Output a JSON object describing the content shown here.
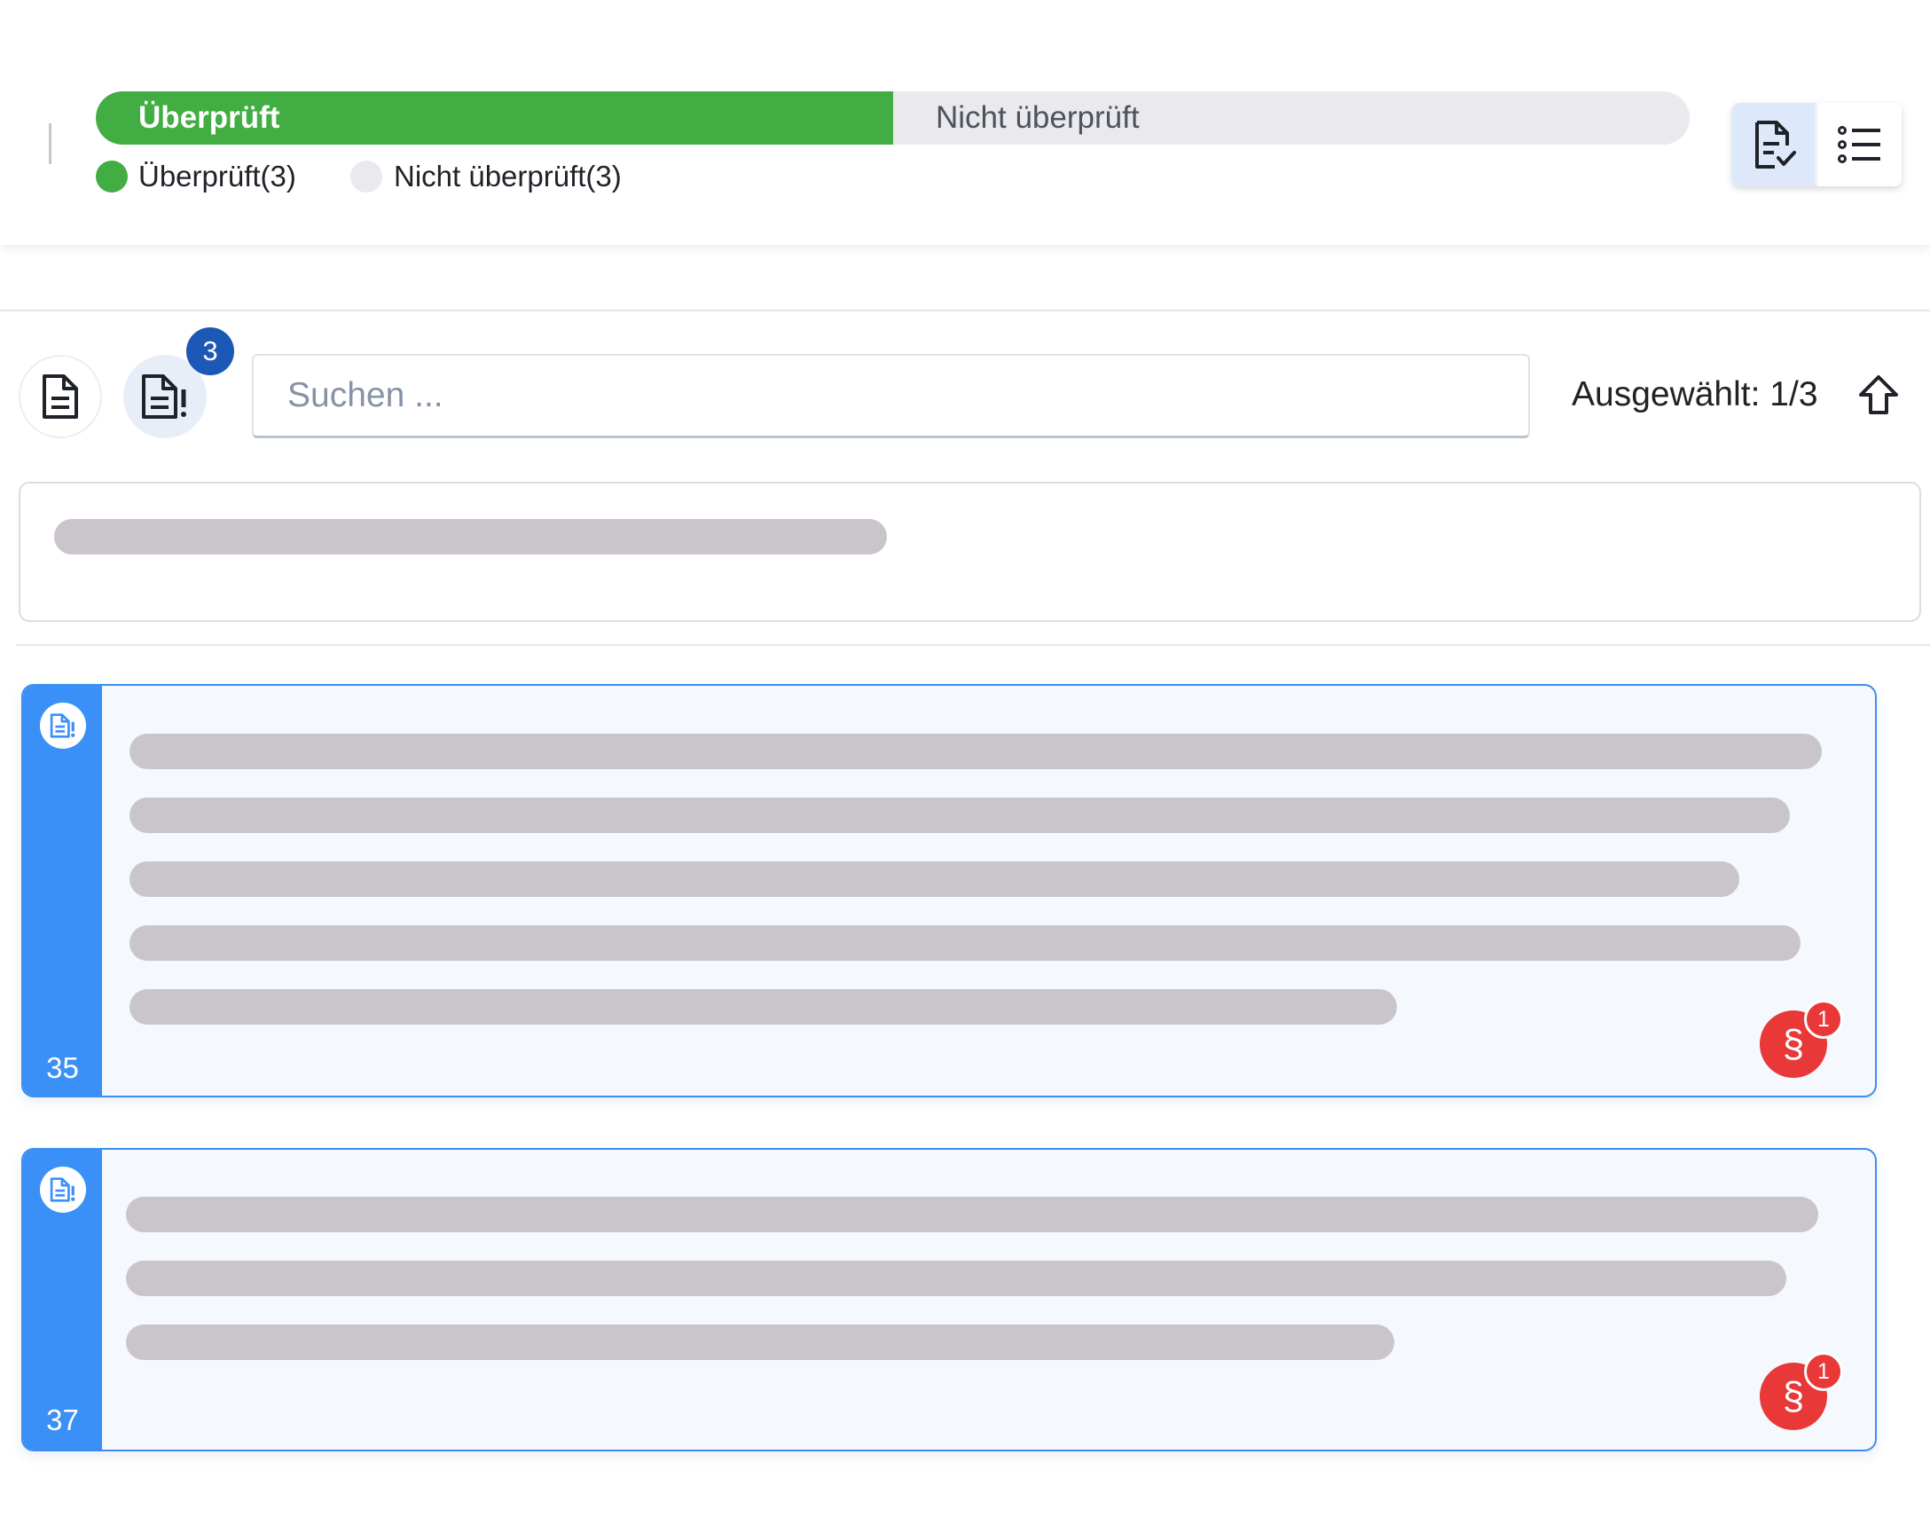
{
  "review_progress": {
    "reviewed_label": "Überprüft",
    "unreviewed_label": "Nicht überprüft",
    "reviewed_fraction": 0.5,
    "legend": [
      {
        "label": "Überprüft(3)",
        "color": "#42ad42"
      },
      {
        "label": "Nicht überprüft(3)",
        "color": "#e9e9ee"
      }
    ]
  },
  "view_toggle": {
    "active": "document-review",
    "options": [
      "document-review-icon",
      "list-icon"
    ]
  },
  "toolbar": {
    "issues_count": "3",
    "search_placeholder": "Suchen ...",
    "selection_status": "Ausgewählt: 1/3"
  },
  "paragraphs": [
    {
      "number": "35",
      "law_issue_count": "1",
      "law_symbol": "§",
      "skeleton_lines": 5
    },
    {
      "number": "37",
      "law_issue_count": "1",
      "law_symbol": "§",
      "skeleton_lines": 3
    }
  ],
  "colors": {
    "accent_green": "#42ad42",
    "accent_blue": "#3a90f6",
    "badge_dark_blue": "#1c58b5",
    "issue_red": "#e83838",
    "skeleton_gray": "#cac5cb"
  }
}
